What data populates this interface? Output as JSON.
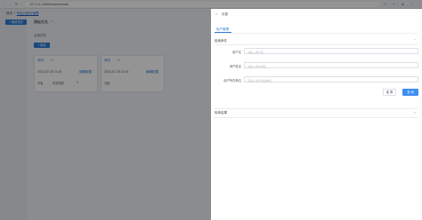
{
  "browser": {
    "url": "127.0.0.1:8080/admin/index"
  },
  "background": {
    "breadcrumb": {
      "prefix": "首页",
      "current": "作业计划与管理"
    },
    "crumb_button": "+ 新增任务",
    "page_title": "模板任务",
    "page_title_close": "×",
    "sub_label": "全部任务",
    "add_button": "+ 新增",
    "cards": [
      {
        "head": "测试",
        "ver": "v1",
        "time": "2022-07-25 11:00",
        "link": "编辑配置",
        "a": "作者",
        "b": "任务类型",
        "c": "3"
      },
      {
        "head": "测试",
        "ver": "v1",
        "time": "2022-07-25 11:00",
        "link": "编辑配置",
        "a": "分组",
        "b": "",
        "c": ""
      }
    ]
  },
  "drawer": {
    "close_glyph": "×",
    "title": "设置",
    "tab": "用户管理",
    "section1": {
      "title": "检索条件",
      "toggle": "^"
    },
    "fields": [
      {
        "label": "用户名",
        "placeholder": "请输入用户名"
      },
      {
        "label": "用户姓名",
        "placeholder": "请输入用户姓名"
      },
      {
        "label": "用户所在单位",
        "placeholder": "请输入用户所在单位"
      }
    ],
    "reset_label": "重 置",
    "ok_label": "查 询",
    "section2": {
      "title": "检索结果",
      "toggle": "v"
    }
  },
  "colors": {
    "accent": "#2e7bd6",
    "primary_button": "#3d8ef0",
    "overlay": "rgba(0,0,0,0.42)"
  },
  "icons": [
    "back-icon",
    "forward-icon",
    "reload-icon",
    "close-icon",
    "chevron-up-icon",
    "chevron-down-icon"
  ]
}
